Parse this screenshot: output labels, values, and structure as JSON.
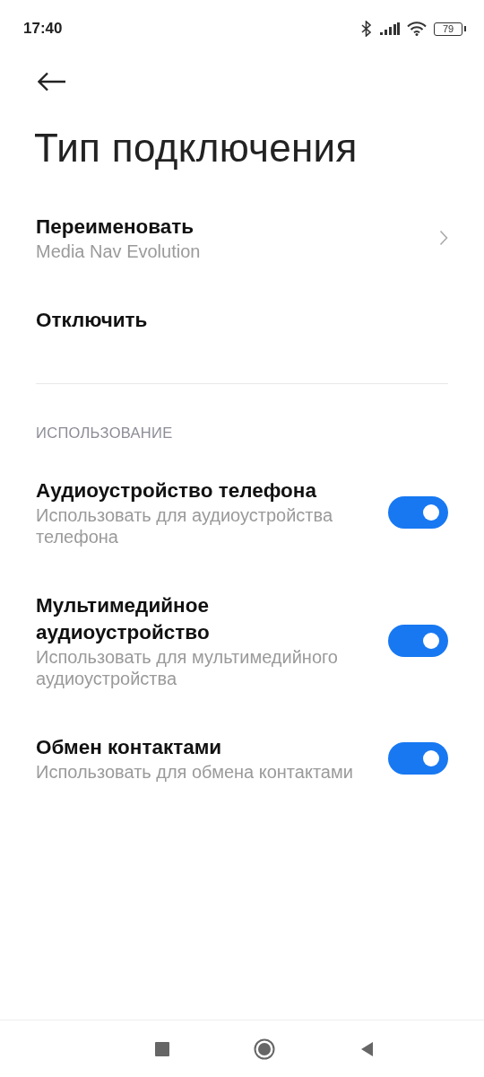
{
  "status_bar": {
    "time": "17:40",
    "battery": "79"
  },
  "header": {
    "title": "Тип подключения"
  },
  "actions": [
    {
      "title": "Переименовать",
      "subtitle": "Media Nav Evolution",
      "chevron": true
    },
    {
      "title": "Отключить"
    }
  ],
  "section": {
    "header": "ИСПОЛЬЗОВАНИЕ",
    "items": [
      {
        "title": "Аудиоустройство телефона",
        "subtitle": "Использовать для аудиоустройства телефона",
        "on": true
      },
      {
        "title": "Мультимедийное аудиоустройство",
        "subtitle": "Использовать для мультимедийного аудиоустройства",
        "on": true
      },
      {
        "title": "Обмен контактами",
        "subtitle": "Использовать для обмена контактами",
        "on": true
      }
    ]
  }
}
